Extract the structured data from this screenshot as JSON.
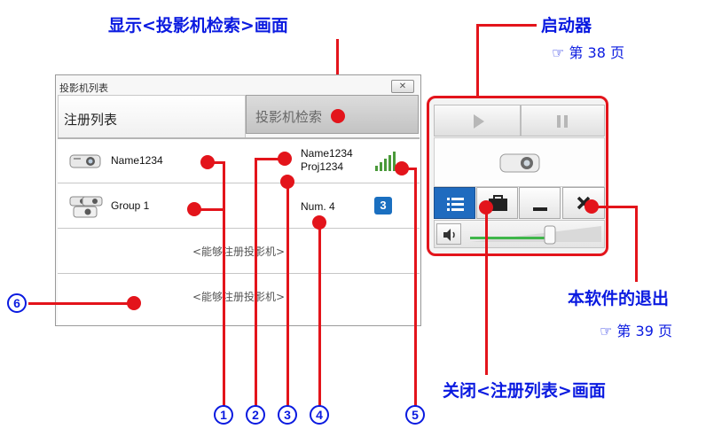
{
  "window": {
    "title": "投影机列表",
    "close_label": "✕",
    "tabs": [
      "注册列表",
      "投影机检索"
    ],
    "rows": [
      {
        "name": "Name1234",
        "detail1": "Name1234",
        "detail2": "Proj1234",
        "indicator": "signal-strength-icon"
      },
      {
        "name": "Group 1",
        "detail1": "Num. 4",
        "detail2": "",
        "badge": "3"
      },
      {
        "placeholder": "<能够注册投影机>"
      },
      {
        "placeholder": "<能够注册投影机>"
      }
    ]
  },
  "launcher": {
    "buttons": [
      "play-icon",
      "pause-icon",
      "list-icon",
      "briefcase-icon",
      "minimize-icon",
      "close-icon",
      "speaker-icon"
    ]
  },
  "annotations": {
    "show_search": "显示<投影机检索>画面",
    "launcher": "启动器",
    "launcher_ref": "☞ 第 38 页",
    "exit": "本软件的退出",
    "exit_ref": "☞ 第 39 页",
    "close_list": "关闭<注册列表>画面",
    "numbers": [
      "1",
      "2",
      "3",
      "4",
      "5",
      "6"
    ]
  },
  "colors": {
    "accent": "#e3141b",
    "label": "#0a1ae0",
    "highlight": "#1f6bbf"
  }
}
